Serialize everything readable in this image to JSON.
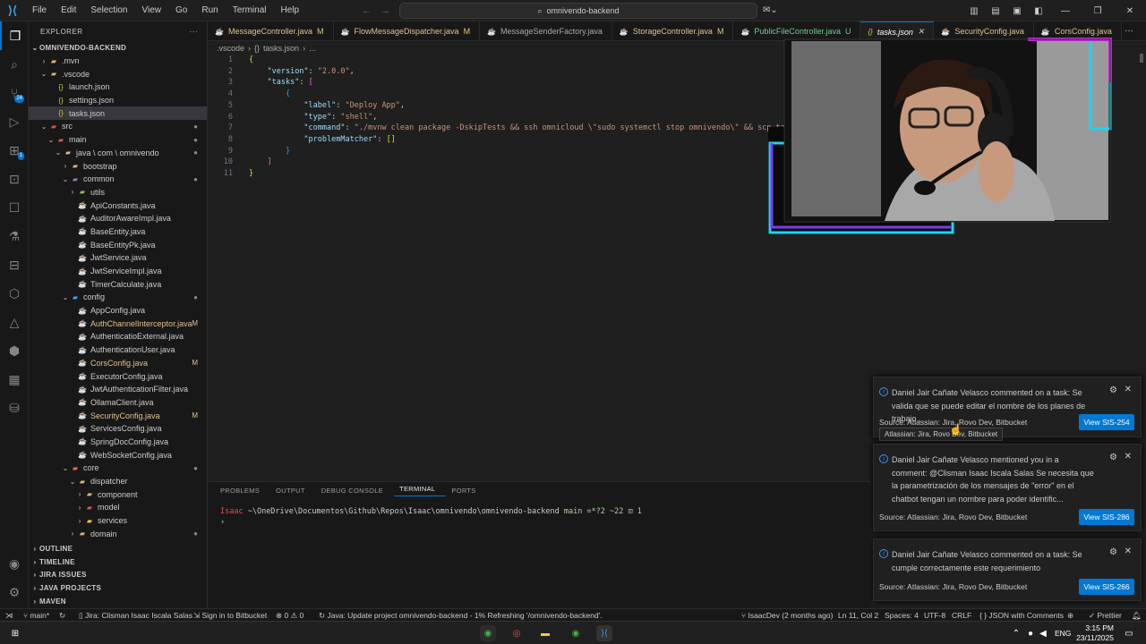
{
  "menu": [
    "File",
    "Edit",
    "Selection",
    "View",
    "Go",
    "Run",
    "Terminal",
    "Help"
  ],
  "command_center": {
    "text": "omnivendo-backend"
  },
  "activity_badges": {
    "source_control": "24",
    "extensions": "1"
  },
  "sidebar": {
    "title": "EXPLORER",
    "root": "OMNIVENDO-BACKEND",
    "tree": [
      {
        "depth": 1,
        "chev": "›",
        "label": ".mvn",
        "icon": "folder-icon",
        "color": "#dcb67a"
      },
      {
        "depth": 1,
        "chev": "⌄",
        "label": ".vscode",
        "icon": "folder-icon",
        "color": "#dcb67a"
      },
      {
        "depth": 2,
        "chev": "",
        "label": "launch.json",
        "icon": "json-icon",
        "color": "#cbcb41"
      },
      {
        "depth": 2,
        "chev": "",
        "label": "settings.json",
        "icon": "json-icon",
        "color": "#cbcb41"
      },
      {
        "depth": 2,
        "chev": "",
        "label": "tasks.json",
        "icon": "json-icon",
        "color": "#cbcb41",
        "selected": true
      },
      {
        "depth": 1,
        "chev": "⌄",
        "label": "src",
        "icon": "folder-icon",
        "color": "#e05252",
        "mark": "●"
      },
      {
        "depth": 2,
        "chev": "⌄",
        "label": "main",
        "icon": "folder-icon",
        "color": "#e05252",
        "mark": "●"
      },
      {
        "depth": 3,
        "chev": "⌄",
        "label": "java \\ com \\ omnivendo",
        "icon": "folder-icon",
        "color": "#dcb67a",
        "mark": "●"
      },
      {
        "depth": 4,
        "chev": "›",
        "label": "bootstrap",
        "icon": "folder-icon",
        "color": "#dcb67a"
      },
      {
        "depth": 4,
        "chev": "⌄",
        "label": "common",
        "icon": "folder-icon",
        "color": "#a074c4",
        "mark": "●"
      },
      {
        "depth": 5,
        "chev": "›",
        "label": "utils",
        "icon": "folder-icon",
        "color": "#8bc34a"
      },
      {
        "depth": 5,
        "chev": "",
        "label": "ApiConstants.java",
        "icon": "java-icon",
        "color": "#e05252"
      },
      {
        "depth": 5,
        "chev": "",
        "label": "AuditorAwareImpl.java",
        "icon": "java-icon",
        "color": "#e05252"
      },
      {
        "depth": 5,
        "chev": "",
        "label": "BaseEntity.java",
        "icon": "java-icon",
        "color": "#e05252"
      },
      {
        "depth": 5,
        "chev": "",
        "label": "BaseEntityPk.java",
        "icon": "java-icon",
        "color": "#e05252"
      },
      {
        "depth": 5,
        "chev": "",
        "label": "JwtService.java",
        "icon": "java-icon",
        "color": "#e05252"
      },
      {
        "depth": 5,
        "chev": "",
        "label": "JwtServiceImpl.java",
        "icon": "java-icon",
        "color": "#e05252"
      },
      {
        "depth": 5,
        "chev": "",
        "label": "TimerCalculate.java",
        "icon": "java-icon",
        "color": "#e05252"
      },
      {
        "depth": 4,
        "chev": "⌄",
        "label": "config",
        "icon": "folder-icon",
        "color": "#42a5f5",
        "mark": "●"
      },
      {
        "depth": 5,
        "chev": "",
        "label": "AppConfig.java",
        "icon": "java-icon",
        "color": "#e05252"
      },
      {
        "depth": 5,
        "chev": "",
        "label": "AuthChannelInterceptor.java",
        "icon": "java-icon",
        "color": "#e05252",
        "mark": "M",
        "modified": true
      },
      {
        "depth": 5,
        "chev": "",
        "label": "AuthenticatioExternal.java",
        "icon": "java-icon",
        "color": "#e05252"
      },
      {
        "depth": 5,
        "chev": "",
        "label": "AuthenticationUser.java",
        "icon": "java-icon",
        "color": "#e05252"
      },
      {
        "depth": 5,
        "chev": "",
        "label": "CorsConfig.java",
        "icon": "java-icon",
        "color": "#e05252",
        "mark": "M",
        "modified": true
      },
      {
        "depth": 5,
        "chev": "",
        "label": "ExecutorConfig.java",
        "icon": "java-icon",
        "color": "#e05252"
      },
      {
        "depth": 5,
        "chev": "",
        "label": "JwtAuthenticationFilter.java",
        "icon": "java-icon",
        "color": "#e05252"
      },
      {
        "depth": 5,
        "chev": "",
        "label": "OllamaClient.java",
        "icon": "java-icon",
        "color": "#e05252"
      },
      {
        "depth": 5,
        "chev": "",
        "label": "SecurityConfig.java",
        "icon": "java-icon",
        "color": "#e05252",
        "mark": "M",
        "modified": true
      },
      {
        "depth": 5,
        "chev": "",
        "label": "ServicesConfig.java",
        "icon": "java-icon",
        "color": "#e05252"
      },
      {
        "depth": 5,
        "chev": "",
        "label": "SpringDocConfig.java",
        "icon": "java-icon",
        "color": "#e05252"
      },
      {
        "depth": 5,
        "chev": "",
        "label": "WebSocketConfig.java",
        "icon": "java-icon",
        "color": "#e05252"
      },
      {
        "depth": 4,
        "chev": "⌄",
        "label": "core",
        "icon": "folder-icon",
        "color": "#ff7043",
        "mark": "●"
      },
      {
        "depth": 5,
        "chev": "⌄",
        "label": "dispatcher",
        "icon": "folder-icon",
        "color": "#dcb67a"
      },
      {
        "depth": 6,
        "chev": "›",
        "label": "component",
        "icon": "folder-icon",
        "color": "#dcb67a"
      },
      {
        "depth": 6,
        "chev": "›",
        "label": "model",
        "icon": "folder-icon",
        "color": "#e05252"
      },
      {
        "depth": 6,
        "chev": "›",
        "label": "services",
        "icon": "folder-icon",
        "color": "#ffca28"
      },
      {
        "depth": 5,
        "chev": "›",
        "label": "domain",
        "icon": "folder-icon",
        "color": "#dcb67a",
        "mark": "●"
      }
    ],
    "sections": [
      "OUTLINE",
      "TIMELINE",
      "JIRA ISSUES",
      "JAVA PROJECTS",
      "MAVEN"
    ]
  },
  "tabs": [
    {
      "label": "MessageController.java",
      "mark": "M",
      "color": "#e2c08d",
      "icon_color": "#e05252"
    },
    {
      "label": "FlowMessageDispatcher.java",
      "mark": "M",
      "color": "#e2c08d",
      "icon_color": "#e05252"
    },
    {
      "label": "MessageSenderFactory.java",
      "mark": "",
      "color": "#a9a9a9",
      "icon_color": "#e05252"
    },
    {
      "label": "StorageController.java",
      "mark": "M",
      "color": "#e2c08d",
      "icon_color": "#e05252"
    },
    {
      "label": "PublicFileController.java",
      "mark": "U",
      "color": "#73c991",
      "icon_color": "#e05252"
    },
    {
      "label": "tasks.json",
      "mark": "✕",
      "color": "#ffffff",
      "icon_color": "#cbcb41",
      "active": true
    },
    {
      "label": "SecurityConfig.java",
      "mark": "",
      "color": "#e2c08d",
      "icon_color": "#e05252"
    },
    {
      "label": "CorsConfig.java",
      "mark": "",
      "color": "#e2c08d",
      "icon_color": "#e05252"
    }
  ],
  "breadcrumb": [
    ".vscode",
    "›",
    "{}",
    "tasks.json",
    "›",
    "..."
  ],
  "editor": {
    "lines": [
      {
        "n": "1",
        "html": "<span class=\"p\">{</span>"
      },
      {
        "n": "2",
        "html": "    <span class=\"k\">\"version\"</span>: <span class=\"s\">\"2.0.0\"</span>,"
      },
      {
        "n": "3",
        "html": "    <span class=\"k\">\"tasks\"</span>: <span class=\"p2\">[</span>"
      },
      {
        "n": "4",
        "html": "        <span class=\"p3\">{</span>"
      },
      {
        "n": "5",
        "html": "            <span class=\"k\">\"label\"</span>: <span class=\"s\">\"Deploy App\"</span>,"
      },
      {
        "n": "6",
        "html": "            <span class=\"k\">\"type\"</span>: <span class=\"s\">\"shell\"</span>,"
      },
      {
        "n": "7",
        "html": "            <span class=\"k\">\"command\"</span>: <span class=\"s\">\"./mvnw clean package -DskipTests &amp;&amp; ssh omnicloud \\\"sudo systemctl stop omnivendo\\\" &amp;&amp; scp ta</span>"
      },
      {
        "n": "8",
        "html": "            <span class=\"k\">\"problemMatcher\"</span>: <span class=\"p\">[]</span>"
      },
      {
        "n": "9",
        "html": "        <span class=\"p3\">}</span>"
      },
      {
        "n": "10",
        "html": "    <span class=\"p2\">]</span>"
      },
      {
        "n": "11",
        "html": "<span class=\"p\">}</span>"
      }
    ]
  },
  "panel": {
    "tabs": [
      "PROBLEMS",
      "OUTPUT",
      "DEBUG CONSOLE",
      "TERMINAL",
      "PORTS"
    ],
    "terminal_user": "Isaac",
    "terminal_path": "~\\OneDrive\\Documentos\\Github\\Repos\\Isaac\\omnivendo\\omnivendo-backend",
    "terminal_branch": "main =*?2 ~22 ⊡ 1",
    "terminal_prompt": "›"
  },
  "notifications": [
    {
      "message": "Daniel Jair Cañate Velasco commented on a task: Se valida que se puede editar el nombre de los planes de trabajo .",
      "source": "Source: Atlassian: Jira, Rovo Dev, Bitbucket",
      "button": "View SIS-254"
    },
    {
      "message": "Daniel Jair Cañate Velasco mentioned you in a comment: @Clisman Isaac Iscala Salas Se necesita que la parametrización de los mensajes de \"error\" en el chatbot tengan un nombre para poder identific...",
      "source": "Source: Atlassian: Jira, Rovo Dev, Bitbucket",
      "button": "View SIS-286"
    },
    {
      "message": "Daniel Jair Cañate Velasco commented on a task: Se cumple correctamente este requerimiento",
      "source": "Source: Atlassian: Jira, Rovo Dev, Bitbucket",
      "button": "View SIS-266"
    }
  ],
  "tooltip": "Atlassian: Jira, Rovo Dev, Bitbucket",
  "statusbar": {
    "branch": "main*",
    "jira": "Jira: Clisman Isaac Iscala Salas",
    "bitbucket": "Sign in to Bitbucket",
    "problems": "⊗ 0 ⚠ 0",
    "java": "Java: Update project omnivendo-backend - 1% Refreshing '/omnivendo-backend'.",
    "blame": "IsaacDev (2 months ago)",
    "position": "Ln 11, Col 2",
    "spaces": "Spaces: 4",
    "encoding": "UTF-8",
    "eol": "CRLF",
    "language": "{ } JSON with Comments",
    "prettier": "✓ Prettier"
  },
  "taskbar": {
    "lang": "ENG",
    "time": "3:15 PM",
    "date": "23/11/2025"
  },
  "colors": {
    "accent": "#0078d4",
    "modified": "#e2c08d",
    "untracked": "#73c991"
  }
}
